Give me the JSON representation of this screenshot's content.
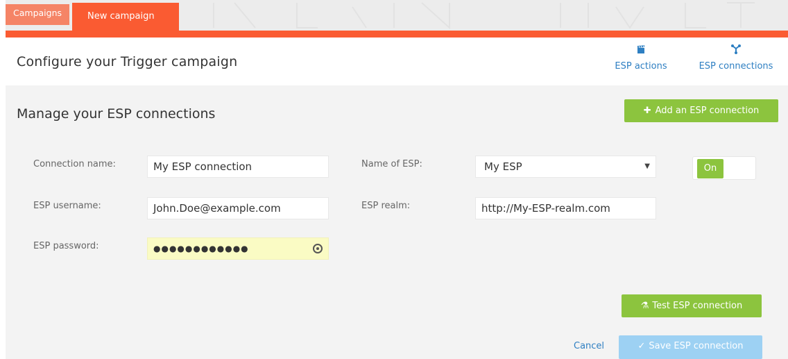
{
  "tabs": [
    {
      "label": "Campaigns"
    },
    {
      "label": "New campaign"
    }
  ],
  "header": {
    "title": "Configure your Trigger campaign",
    "links": [
      {
        "label": "ESP actions",
        "icon": "clapperboard-icon"
      },
      {
        "label": "ESP connections",
        "icon": "network-icon"
      }
    ]
  },
  "section": {
    "title": "Manage your ESP connections",
    "add_button": {
      "label": "Add an ESP connection",
      "icon": "plus-icon"
    }
  },
  "form": {
    "connection_name": {
      "label": "Connection name:",
      "value": "My ESP connection"
    },
    "esp_name": {
      "label": "Name of ESP:",
      "value": "My ESP"
    },
    "toggle": {
      "label": "On"
    },
    "esp_username": {
      "label": "ESP username:",
      "value": "John.Doe@example.com"
    },
    "esp_realm": {
      "label": "ESP realm:",
      "value": "http://My-ESP-realm.com"
    },
    "esp_password": {
      "label": "ESP password:",
      "value": "●●●●●●●●●●●●"
    }
  },
  "actions": {
    "test_label": "Test ESP connection",
    "cancel_label": "Cancel",
    "save_label": "Save ESP connection"
  },
  "colors": {
    "accent_orange": "#fa5b32",
    "green": "#8cc43e",
    "link_blue": "#2e7fc2",
    "disabled_blue": "#9dd1f3"
  }
}
